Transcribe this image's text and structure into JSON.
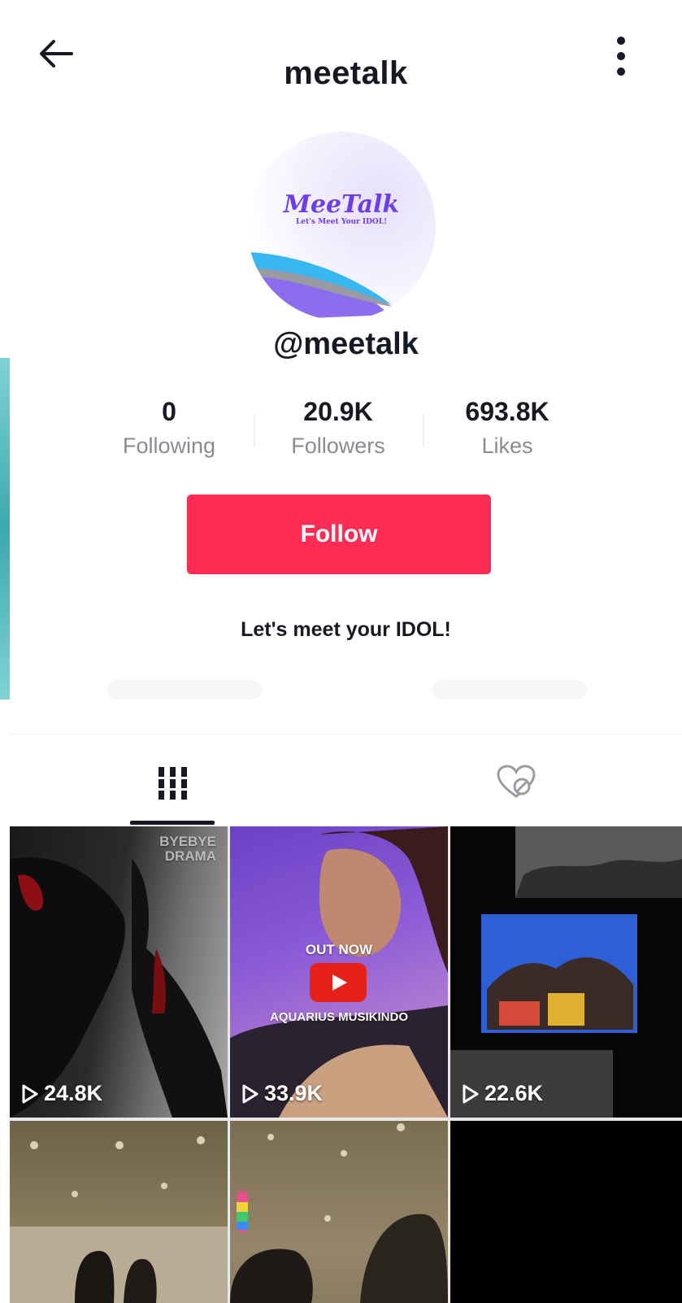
{
  "header": {
    "title": "meetalk"
  },
  "profile": {
    "logo_text": "MeeTalk",
    "logo_tagline": "Let's Meet Your IDOL!",
    "handle": "@meetalk",
    "bio": "Let's meet your IDOL!"
  },
  "stats": [
    {
      "value": "0",
      "label": "Following"
    },
    {
      "value": "20.9K",
      "label": "Followers"
    },
    {
      "value": "693.8K",
      "label": "Likes"
    }
  ],
  "follow_button": {
    "label": "Follow",
    "color": "#fe2c55"
  },
  "tabs": [
    {
      "icon": "videos-grid-icon",
      "selected": true
    },
    {
      "icon": "liked-videos-hidden-icon",
      "selected": false
    }
  ],
  "videos": [
    {
      "views": "24.8K",
      "overlay": "BYEBYE DRAMA"
    },
    {
      "views": "33.9K",
      "overlay_top": "OUT NOW",
      "overlay_bottom": "AQUARIUS MUSIKINDO"
    },
    {
      "views": "22.6K"
    },
    {
      "views": ""
    },
    {
      "views": ""
    },
    {
      "views": ""
    }
  ]
}
